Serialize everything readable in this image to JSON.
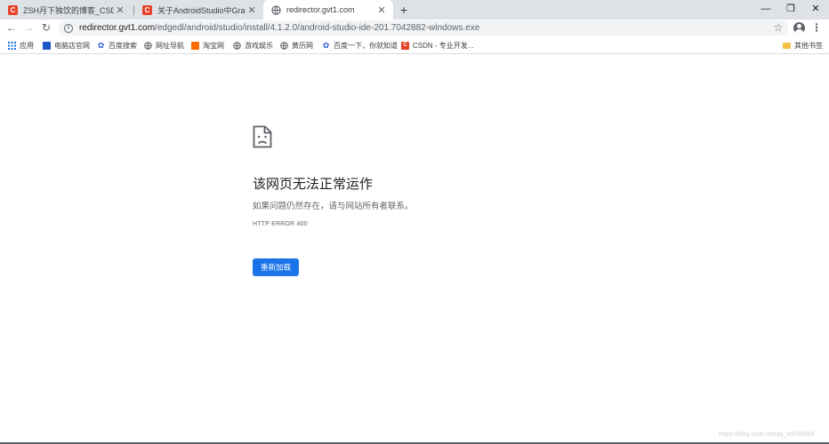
{
  "tabs": [
    {
      "title": "ZSH月下独饮的博客_CSDN博客",
      "favicon": "csdn-icon",
      "favicon_text": "C",
      "active": false
    },
    {
      "title": "关于AndroidStudio中Gradle文件",
      "favicon": "csdn-icon",
      "favicon_text": "C",
      "active": false
    },
    {
      "title": "redirector.gvt1.com",
      "favicon": "globe-icon",
      "favicon_text": "",
      "active": true
    }
  ],
  "tab_close_glyph": "✕",
  "new_tab_glyph": "+",
  "window_controls": {
    "minimize": "—",
    "restore": "❐",
    "close": "✕"
  },
  "nav": {
    "back": "←",
    "forward": "→",
    "reload": "↻"
  },
  "address": {
    "host": "redirector.gvt1.com",
    "path": "/edgedl/android/studio/install/4.1.2.0/android-studio-ide-201.7042882-windows.exe",
    "info_glyph": "i"
  },
  "star_glyph": "☆",
  "menu_glyph": "⋮",
  "bookmarks": [
    {
      "label": "应用",
      "icon": "apps-icon"
    },
    {
      "label": "电脑店官网",
      "icon": "site-icon"
    },
    {
      "label": "百度搜索",
      "icon": "paw-icon"
    },
    {
      "label": "网址导航",
      "icon": "globe-icon"
    },
    {
      "label": "淘宝网",
      "icon": "taobao-icon"
    },
    {
      "label": "游戏娱乐",
      "icon": "globe-icon"
    },
    {
      "label": "黄历网",
      "icon": "globe-icon"
    },
    {
      "label": "百度一下，你就知道",
      "icon": "paw-icon"
    },
    {
      "label": "CSDN - 专业开发...",
      "icon": "csdn-icon"
    }
  ],
  "other_bookmarks": {
    "label": "其他书签",
    "icon": "folder-icon"
  },
  "error_page": {
    "title": "该网页无法正常运作",
    "description": "如果问题仍然存在，请与网站所有者联系。",
    "code": "HTTP ERROR 400",
    "reload_label": "重新加载"
  },
  "watermark": "https://blog.csdn.net/qq_43790955",
  "colors": {
    "accent": "#1a73e8",
    "csdn": "#e8412a",
    "tabstrip": "#dee1e6"
  }
}
